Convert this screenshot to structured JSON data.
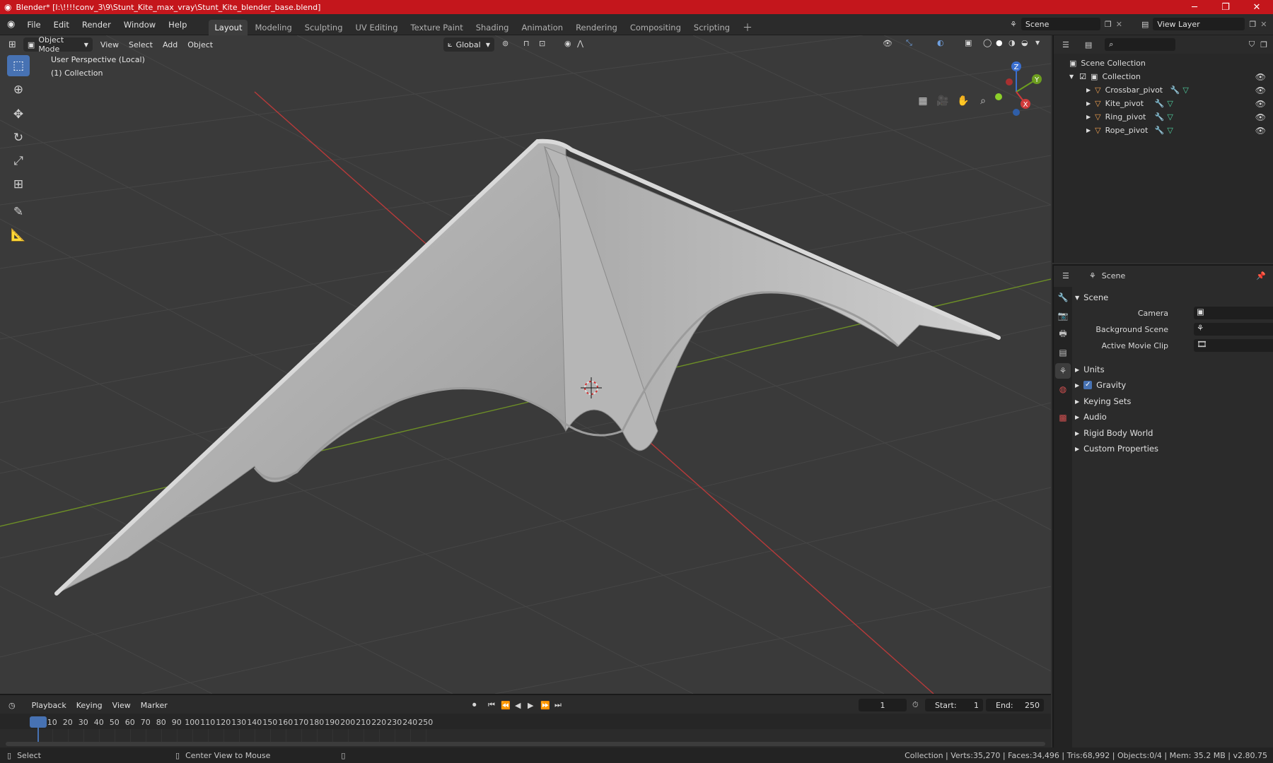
{
  "window": {
    "title": "Blender* [I:\\!!!!conv_3\\9\\Stunt_Kite_max_vray\\Stunt_Kite_blender_base.blend]"
  },
  "menu": [
    "File",
    "Edit",
    "Render",
    "Window",
    "Help"
  ],
  "workspaces": [
    "Layout",
    "Modeling",
    "Sculpting",
    "UV Editing",
    "Texture Paint",
    "Shading",
    "Animation",
    "Rendering",
    "Compositing",
    "Scripting"
  ],
  "active_workspace": "Layout",
  "scene_field": "Scene",
  "view_layer_field": "View Layer",
  "viewport": {
    "mode": "Object Mode",
    "menus": [
      "View",
      "Select",
      "Add",
      "Object"
    ],
    "transform_orientation": "Global",
    "perspective_label": "User Perspective (Local)",
    "collection_label": "(1) Collection",
    "gizmo_axes": {
      "z": "Z",
      "y": "Y",
      "x": "X"
    }
  },
  "outliner": {
    "root": "Scene Collection",
    "collection": "Collection",
    "objects": [
      "Crossbar_pivot",
      "Kite_pivot",
      "Ring_pivot",
      "Rope_pivot"
    ]
  },
  "properties": {
    "context": "Scene",
    "panel_title": "Scene",
    "fields": [
      {
        "label": "Camera"
      },
      {
        "label": "Background Scene"
      },
      {
        "label": "Active Movie Clip"
      }
    ],
    "subpanels": [
      "Units",
      "Gravity",
      "Keying Sets",
      "Audio",
      "Rigid Body World",
      "Custom Properties"
    ],
    "gravity_checked": true
  },
  "timeline": {
    "menus": [
      "Playback",
      "Keying",
      "View",
      "Marker"
    ],
    "current_frame": "1",
    "start_label": "Start:",
    "start": "1",
    "end_label": "End:",
    "end": "250",
    "ticks": [
      "1",
      "10",
      "20",
      "30",
      "40",
      "50",
      "60",
      "70",
      "80",
      "90",
      "100",
      "110",
      "120",
      "130",
      "140",
      "150",
      "160",
      "170",
      "180",
      "190",
      "200",
      "210",
      "220",
      "230",
      "240",
      "250"
    ]
  },
  "statusbar": {
    "left_action": "Select",
    "middle_action": "Center View to Mouse",
    "stats": "Collection | Verts:35,270 | Faces:34,496 | Tris:68,992 | Objects:0/4 | Mem: 35.2 MB | v2.80.75"
  },
  "colors": {
    "titlebar": "#c4161c",
    "accent": "#4772b3",
    "x_axis": "#b83a3a",
    "y_axis": "#6d8f26"
  }
}
